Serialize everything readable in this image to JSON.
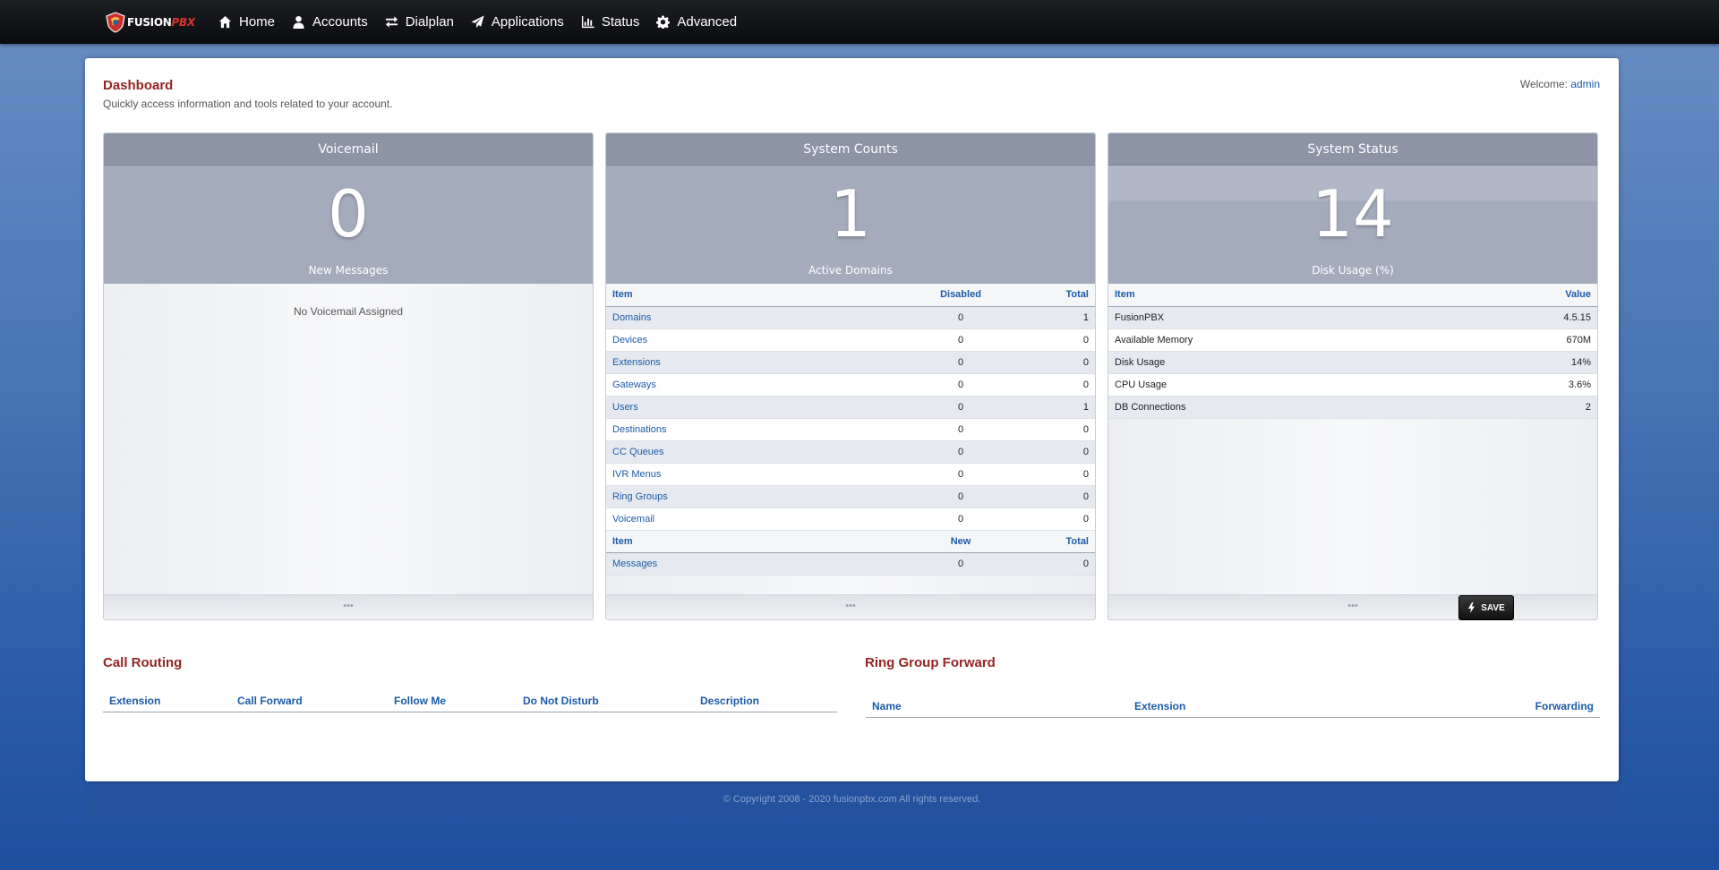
{
  "nav": {
    "logo_prefix": "FUSION",
    "logo_suffix": "PBX",
    "items": [
      {
        "label": "Home",
        "icon": "home-icon"
      },
      {
        "label": "Accounts",
        "icon": "user-icon"
      },
      {
        "label": "Dialplan",
        "icon": "exchange-icon"
      },
      {
        "label": "Applications",
        "icon": "paper-plane-icon"
      },
      {
        "label": "Status",
        "icon": "bar-chart-icon"
      },
      {
        "label": "Advanced",
        "icon": "gear-icon"
      }
    ]
  },
  "page": {
    "title": "Dashboard",
    "description": "Quickly access information and tools related to your account.",
    "welcome_label": "Welcome:",
    "welcome_user": "admin"
  },
  "voicemail": {
    "title": "Voicemail",
    "count": "0",
    "caption": "New Messages",
    "empty_text": "No Voicemail Assigned",
    "footer": "•••"
  },
  "system_counts": {
    "title": "System Counts",
    "count": "1",
    "caption": "Active Domains",
    "headers": [
      "Item",
      "Disabled",
      "Total"
    ],
    "rows": [
      [
        "Domains",
        "0",
        "1"
      ],
      [
        "Devices",
        "0",
        "0"
      ],
      [
        "Extensions",
        "0",
        "0"
      ],
      [
        "Gateways",
        "0",
        "0"
      ],
      [
        "Users",
        "0",
        "1"
      ],
      [
        "Destinations",
        "0",
        "0"
      ],
      [
        "CC Queues",
        "0",
        "0"
      ],
      [
        "IVR Menus",
        "0",
        "0"
      ],
      [
        "Ring Groups",
        "0",
        "0"
      ],
      [
        "Voicemail",
        "0",
        "0"
      ]
    ],
    "headers2": [
      "Item",
      "New",
      "Total"
    ],
    "rows2": [
      [
        "Messages",
        "0",
        "0"
      ]
    ],
    "footer": "•••"
  },
  "system_status": {
    "title": "System Status",
    "count": "14",
    "caption": "Disk Usage (%)",
    "headers": [
      "Item",
      "Value"
    ],
    "rows": [
      [
        "FusionPBX",
        "4.5.15"
      ],
      [
        "Available Memory",
        "670M"
      ],
      [
        "Disk Usage",
        "14%"
      ],
      [
        "CPU Usage",
        "3.6%"
      ],
      [
        "DB Connections",
        "2"
      ]
    ],
    "footer": "•••"
  },
  "call_routing": {
    "title": "Call Routing",
    "headers": [
      "Extension",
      "Call Forward",
      "Follow Me",
      "Do Not Disturb",
      "Description"
    ]
  },
  "ring_group_forward": {
    "title": "Ring Group Forward",
    "save_label": "SAVE",
    "headers": [
      "Name",
      "Extension",
      "Forwarding"
    ]
  },
  "footer": {
    "copyright": "© Copyright 2008 - 2020 fusionpbx.com All rights reserved."
  }
}
